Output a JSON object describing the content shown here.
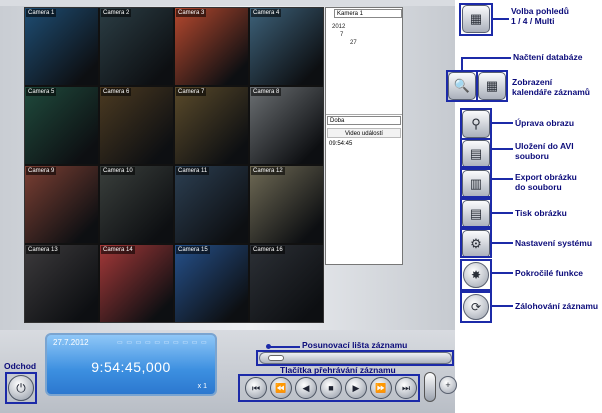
{
  "cameras": [
    {
      "label": "Camera 1",
      "color": "#1e4d73"
    },
    {
      "label": "Camera 2",
      "color": "#2b3d44"
    },
    {
      "label": "Camera 3",
      "color": "#b5482e"
    },
    {
      "label": "Camera 4",
      "color": "#3d6179"
    },
    {
      "label": "Camera 5",
      "color": "#1f4a3c"
    },
    {
      "label": "Camera 6",
      "color": "#4b3a21"
    },
    {
      "label": "Camera 7",
      "color": "#5a4a2a"
    },
    {
      "label": "Camera 8",
      "color": "#6b6f72"
    },
    {
      "label": "Camera 9",
      "color": "#7b3f33"
    },
    {
      "label": "Camera 10",
      "color": "#3a3f3c"
    },
    {
      "label": "Camera 11",
      "color": "#2c3f52"
    },
    {
      "label": "Camera 12",
      "color": "#6f6a55"
    },
    {
      "label": "Camera 13",
      "color": "#3c3a3c"
    },
    {
      "label": "Camera 14",
      "color": "#a33838"
    },
    {
      "label": "Camera 15",
      "color": "#25508a"
    },
    {
      "label": "Camera 16",
      "color": "#2c3036"
    }
  ],
  "side_panel": {
    "camera_select": "Kamera 1",
    "tree": [
      "2012",
      "7",
      "27"
    ],
    "mode_select": "Doba",
    "events_header": "Video událostí",
    "event_time": "09:54:45"
  },
  "lcd": {
    "date": "27.7.2012",
    "time": "9:54:45,000",
    "speed": "x 1",
    "icons": "▭ ▭ ▭ ▭ ▭ ▭ ▭ ▭ ▭ ▭"
  },
  "icons": {
    "view": "▦",
    "database": "🔍",
    "calendar": "▦",
    "image_adjust": "⚲",
    "avi": "▤",
    "export": "▥",
    "print": "▤",
    "settings": "⚙",
    "advanced": "✸",
    "backup": "⟳",
    "exit": "⏻"
  },
  "playback": [
    "⏮",
    "⏪",
    "◀",
    "■",
    "▶",
    "⏩",
    "⏭"
  ],
  "annotations": {
    "view": "Volba pohledů\n1 / 4 / Multi",
    "database": "Načtení databáze",
    "calendar": "Zobrazení\nkalendáře záznamů",
    "image_adjust": "Úprava obrazu",
    "avi": "Uložení do AVI\nsouboru",
    "export": "Export obrázku\ndo souboru",
    "print": "Tisk obrázku",
    "settings": "Nastavení systému",
    "advanced": "Pokročilé funkce",
    "backup": "Zálohování záznamu",
    "scroll": "Posunovací lišta záznamu",
    "playback": "Tlačítka přehrávání záznamu",
    "exit": "Odchod"
  },
  "colors": {
    "accent": "#1c2aa8",
    "annotation": "#0b0b7a"
  }
}
